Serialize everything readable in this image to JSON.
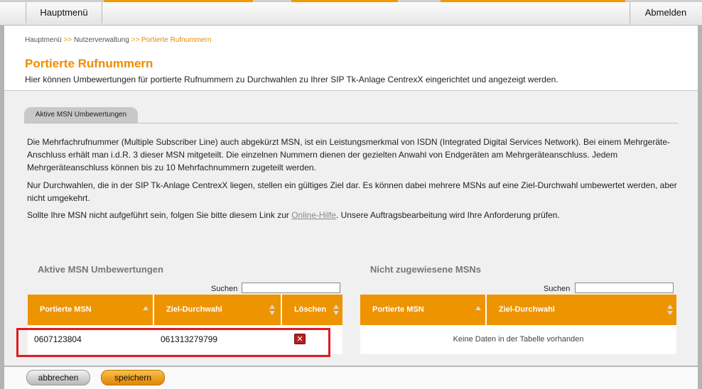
{
  "colors": {
    "accent": "#ee9400",
    "title": "#ee8c00",
    "highlight": "#e01a24",
    "delete": "#b61f1f"
  },
  "nav": {
    "home": "Hauptmenü",
    "logout": "Abmelden"
  },
  "breadcrumb": {
    "items": [
      "Hauptmenü",
      "Nutzerverwaltung",
      "Portierte Rufnummern"
    ],
    "separator": ">>"
  },
  "page": {
    "title": "Portierte Rufnummern",
    "description": "Hier können Umbewertungen für portierte Rufnummern zu Durchwahlen zu Ihrer SIP Tk-Anlage CentrexX eingerichtet und angezeigt werden."
  },
  "tab": {
    "label": "Aktive MSN Umbewertungen"
  },
  "info": {
    "p1": "Die Mehrfachrufnummer (Multiple Subscriber Line) auch abgekürzt MSN, ist ein Leistungsmerkmal von ISDN (Integrated Digital Services Network). Bei einem Mehrgeräte-Anschluss erhält man i.d.R. 3 dieser MSN mitgeteilt. Die einzelnen Nummern dienen der gezielten Anwahl von Endgeräten am Mehrgeräteanschluss. Jedem Mehrgeräteanschluss können bis zu 10 Mehrfachnummern zugeteilt werden.",
    "p2": "Nur Durchwahlen, die in der SIP Tk-Anlage CentrexX liegen, stellen ein gültiges Ziel dar. Es können dabei mehrere MSNs auf eine Ziel-Durchwahl umbewertet werden, aber nicht umgekehrt.",
    "p3_before": "Sollte Ihre MSN nicht aufgeführt sein, folgen Sie bitte diesem Link zur ",
    "p3_link": "Online-Hilfe",
    "p3_after": ". Unsere Auftragsbearbeitung wird Ihre Anforderung prüfen."
  },
  "active_table": {
    "title": "Aktive MSN Umbewertungen",
    "search_label": "Suchen",
    "search_value": "",
    "columns": [
      "Portierte MSN",
      "Ziel-Durchwahl",
      "Löschen"
    ],
    "rows": [
      {
        "msn": "0607123804",
        "target": "061313279799",
        "delete_icon": "close-icon"
      }
    ]
  },
  "unassigned_table": {
    "title": "Nicht zugewiesene MSNs",
    "search_label": "Suchen",
    "search_value": "",
    "columns": [
      "Portierte MSN",
      "Ziel-Durchwahl"
    ],
    "empty_message": "Keine Daten in der Tabelle vorhanden"
  },
  "footer": {
    "cancel": "abbrechen",
    "save": "speichern"
  }
}
